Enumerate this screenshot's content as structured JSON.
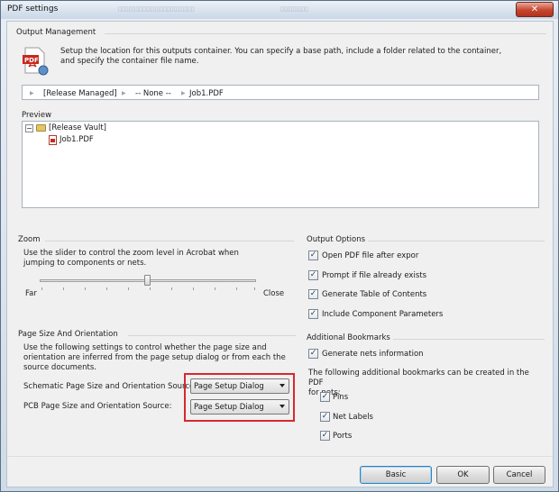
{
  "window": {
    "title": "PDF settings",
    "close_label": "✕"
  },
  "output_management": {
    "heading": "Output Management",
    "description_line1": "Setup the location for this outputs container. You can specify a base path, include a folder related to the container,",
    "description_line2": "and specify the container file name.",
    "path": {
      "part1": "[Release Managed]",
      "part2": "-- None --",
      "part3": "Job1.PDF"
    },
    "preview_heading": "Preview",
    "tree": {
      "root_label": "[Release Vault]",
      "child_label": "Job1.PDF",
      "collapse_symbol": "−"
    }
  },
  "zoom": {
    "heading": "Zoom",
    "description_line1": "Use the slider to control the zoom level in Acrobat when",
    "description_line2": "jumping to components or nets.",
    "far_label": "Far",
    "close_label": "Close",
    "slider_level": 0.5
  },
  "page_size": {
    "heading": "Page Size And Orientation",
    "description_line1": "Use the following settings to control whether the page size and",
    "description_line2": "orientation are inferred from the page setup dialog or from each the",
    "description_line3": "source documents.",
    "schematic_label": "Schematic Page Size and Orientation Source:",
    "schematic_value": "Page Setup Dialog",
    "pcb_label": "PCB Page Size and Orientation Source:",
    "pcb_value": "Page Setup Dialog",
    "highlight_color": "#d62830"
  },
  "output_options": {
    "heading": "Output Options",
    "open_pdf": "Open PDF file after expor",
    "prompt_exists": "Prompt if file already exists",
    "generate_toc": "Generate Table of Contents",
    "include_params": "Include Component Parameters"
  },
  "bookmarks": {
    "heading": "Additional Bookmarks",
    "generate_nets": "Generate nets information",
    "description_line1": "The following additional bookmarks can be created in the PDF",
    "description_line2": "for nets:",
    "pins": "Pins",
    "net_labels": "Net Labels",
    "ports": "Ports"
  },
  "checks": {
    "mark": "✓"
  },
  "buttons": {
    "basic": "Basic",
    "ok": "OK",
    "cancel": "Cancel"
  }
}
